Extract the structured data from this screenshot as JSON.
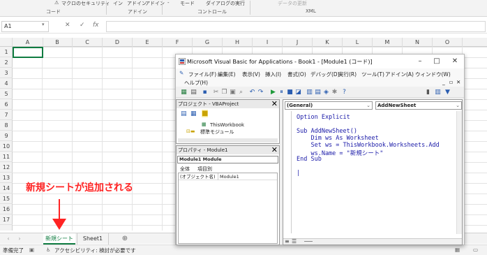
{
  "ribbon": {
    "items": [
      "マクロのセキュリティ",
      "イン",
      "アドイン",
      "アドイン",
      "モード",
      "ダイアログの実行",
      "データの更新"
    ],
    "groups": [
      "コード",
      "アドイン",
      "コントロール",
      "XML"
    ]
  },
  "formula_bar": {
    "name_box": "A1",
    "cancel": "✕",
    "enter": "✓",
    "fx": "fx"
  },
  "columns": [
    "A",
    "B",
    "C",
    "D",
    "E",
    "F",
    "G",
    "H",
    "I",
    "J",
    "K",
    "L",
    "M",
    "N",
    "O"
  ],
  "rows": [
    "1",
    "2",
    "3",
    "4",
    "5",
    "6",
    "7",
    "8",
    "9",
    "10",
    "11",
    "12",
    "13",
    "14",
    "15",
    "16",
    "17"
  ],
  "sheet_tabs": {
    "active": "新規シート",
    "other": "Sheet1",
    "add": "⊕"
  },
  "status_bar": {
    "ready": "準備完了",
    "accessibility": "アクセシビリティ: 検討が必要です"
  },
  "annotation": {
    "text": "新規シートが追加される",
    "color": "#ff2323"
  },
  "vbe": {
    "title": "Microsoft Visual Basic for Applications - Book1 - [Module1 (コード)]",
    "menu": [
      "ファイル(F)",
      "編集(E)",
      "表示(V)",
      "挿入(I)",
      "書式(O)",
      "デバッグ(D)",
      "実行(R)",
      "ツール(T)",
      "アドイン(A)",
      "ウィンドウ(W)",
      "ヘルプ(H)"
    ],
    "project": {
      "title": "プロジェクト - VBAProject",
      "items": [
        "ThisWorkbook",
        "標準モジュール"
      ]
    },
    "properties": {
      "title": "プロパティ - Module1",
      "object": "Module1 Module",
      "tabs": [
        "全体",
        "項目別"
      ],
      "row_name": "(オブジェクト名)",
      "row_value": "Module1"
    },
    "code": {
      "object_combo": "(General)",
      "proc_combo": "AddNewSheet",
      "lines": [
        "Option Explicit",
        "",
        "Sub AddNewSheet()",
        "    Dim ws As Worksheet",
        "    Set ws = ThisWorkbook.Worksheets.Add",
        "    ws.Name = \"新規シート\"",
        "End Sub",
        "",
        "|"
      ]
    }
  },
  "colors": {
    "excel_green": "#107c41",
    "code_blue": "#1a1aa8"
  }
}
